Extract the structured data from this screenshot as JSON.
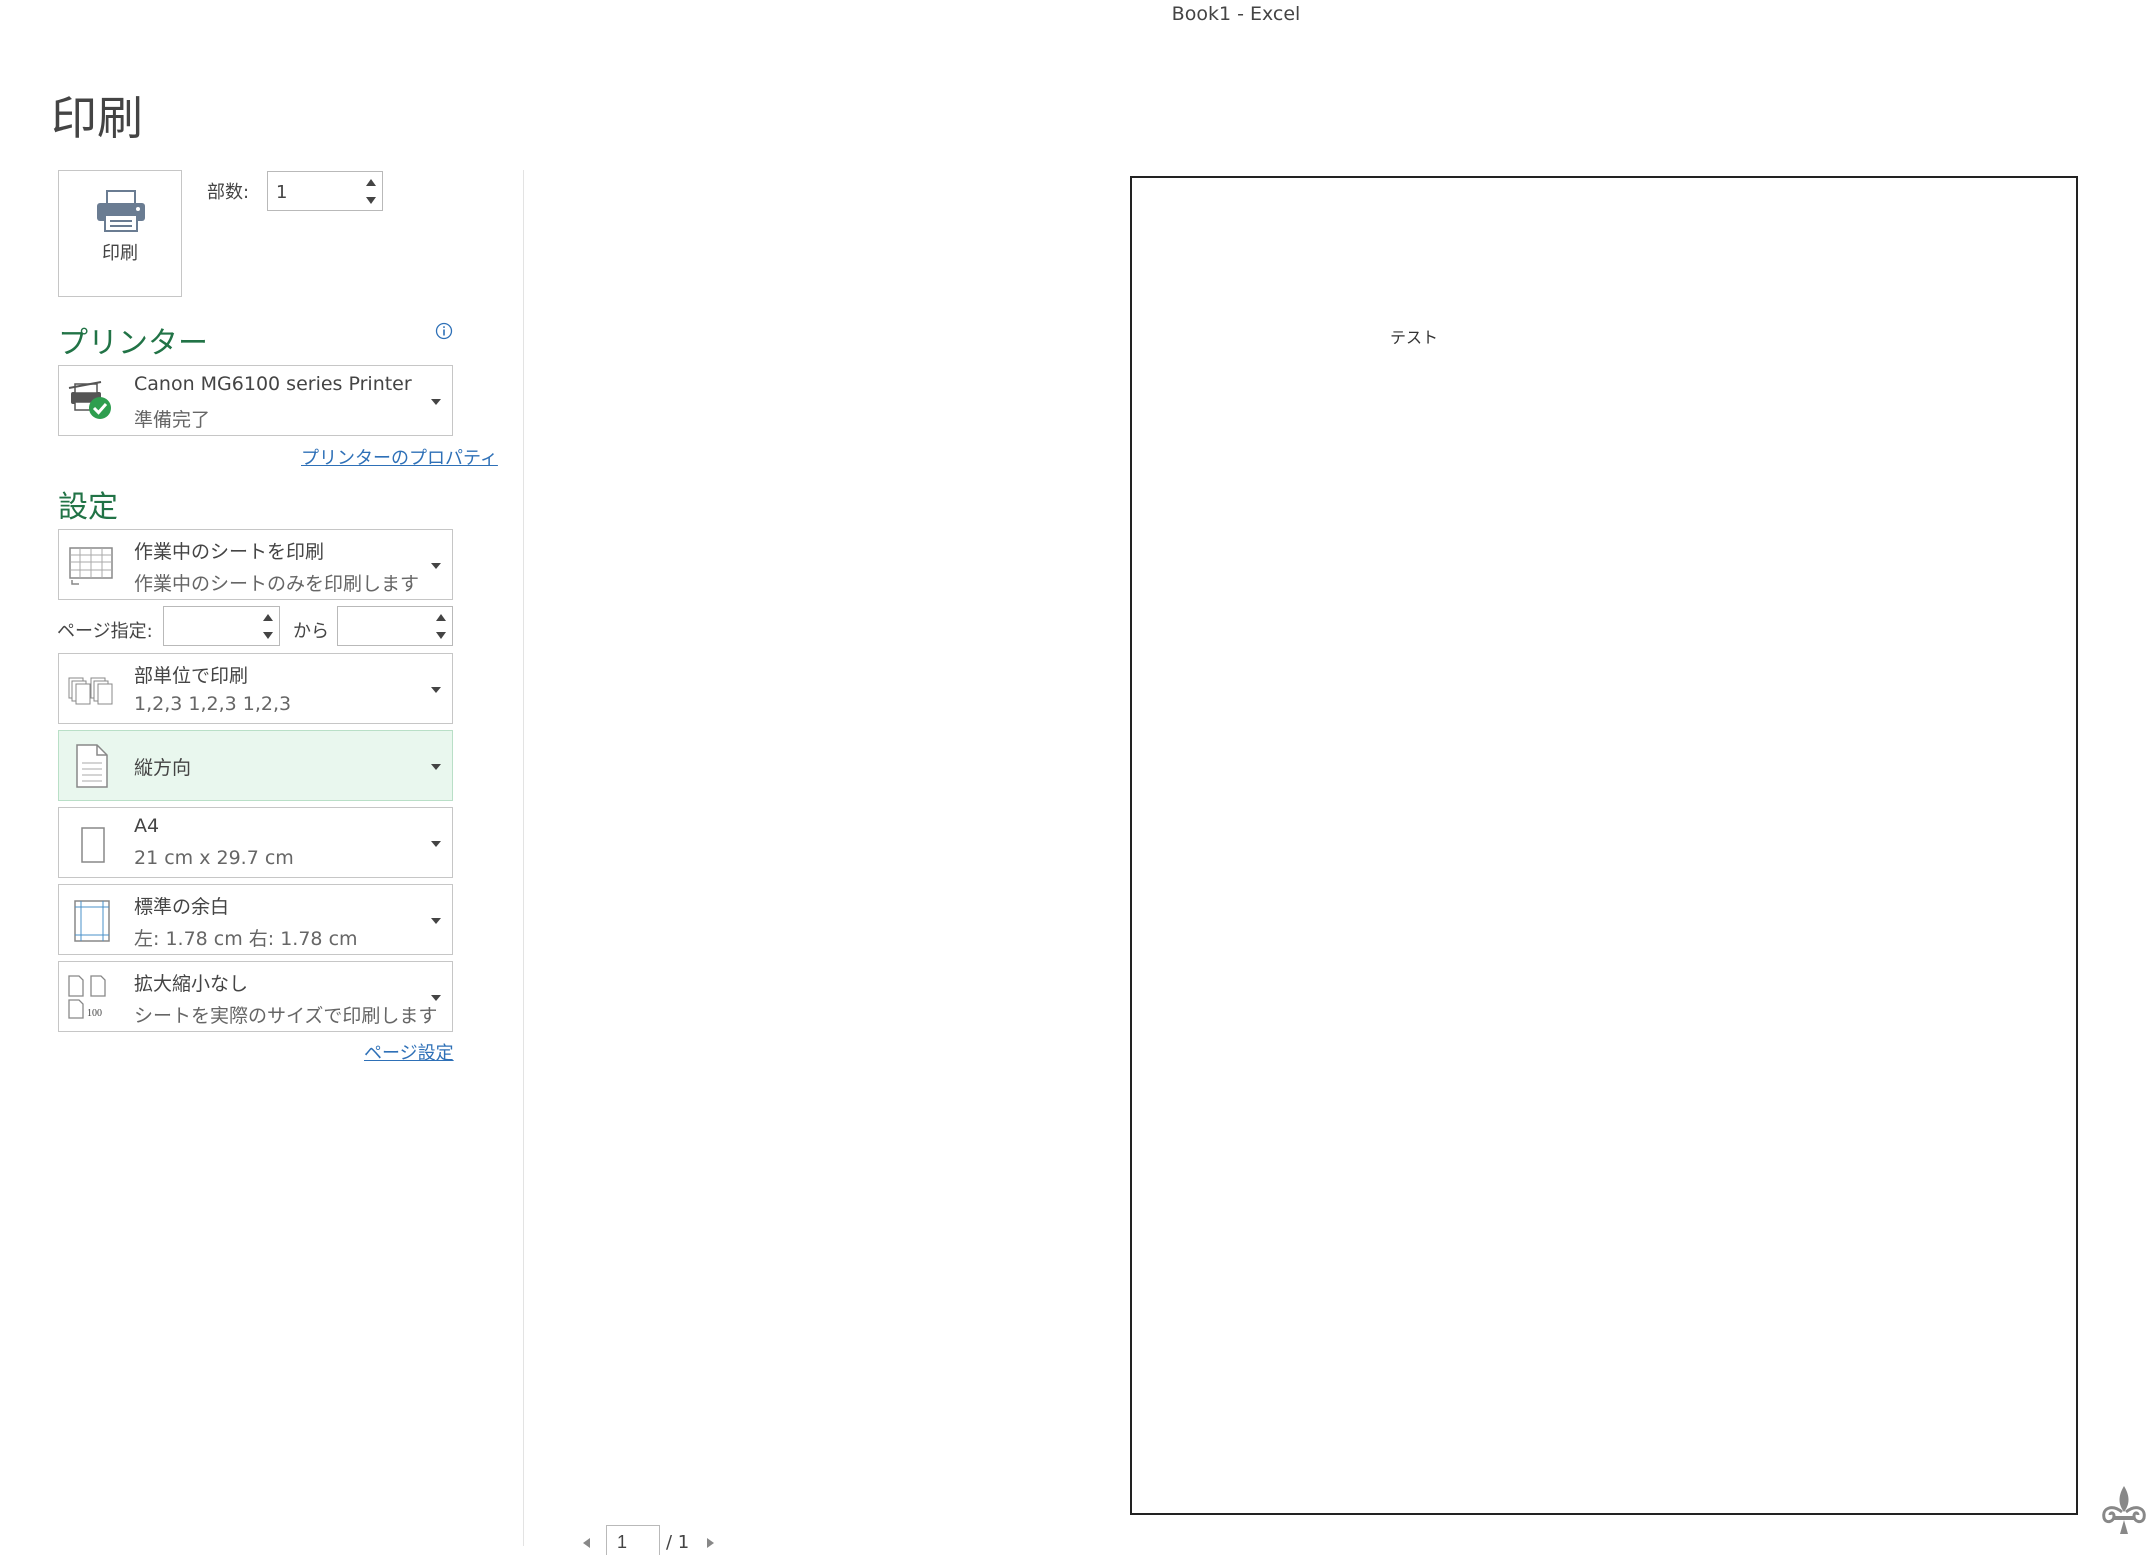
{
  "window": {
    "title": "Book1  -  Excel"
  },
  "page_title": "印刷",
  "print_button": {
    "label": "印刷"
  },
  "copies": {
    "label": "部数:",
    "value": "1"
  },
  "printer": {
    "heading": "プリンター",
    "name": "Canon MG6100 series Printer",
    "status": "準備完了",
    "properties_link": "プリンターのプロパティ"
  },
  "settings": {
    "heading": "設定",
    "scope": {
      "main": "作業中のシートを印刷",
      "sub": "作業中のシートのみを印刷します"
    },
    "page_range": {
      "label": "ページ指定:",
      "from_value": "",
      "to_label": "から",
      "to_value": ""
    },
    "collation": {
      "main": "部単位で印刷",
      "sub": "1,2,3    1,2,3    1,2,3"
    },
    "orientation": {
      "main": "縦方向"
    },
    "paper": {
      "main": "A4",
      "sub": "21 cm x 29.7 cm"
    },
    "margins": {
      "main": "標準の余白",
      "sub": "左:  1.78 cm    右:  1.78 cm"
    },
    "scaling": {
      "main": "拡大縮小なし",
      "sub": "シートを実際のサイズで印刷します"
    },
    "page_setup_link": "ページ設定"
  },
  "preview": {
    "cell_text": "テスト"
  },
  "page_nav": {
    "current": "1",
    "total": "/ 1"
  },
  "colors": {
    "accent": "#217346",
    "link": "#2e70b7",
    "highlight": "#e9f7ee"
  }
}
